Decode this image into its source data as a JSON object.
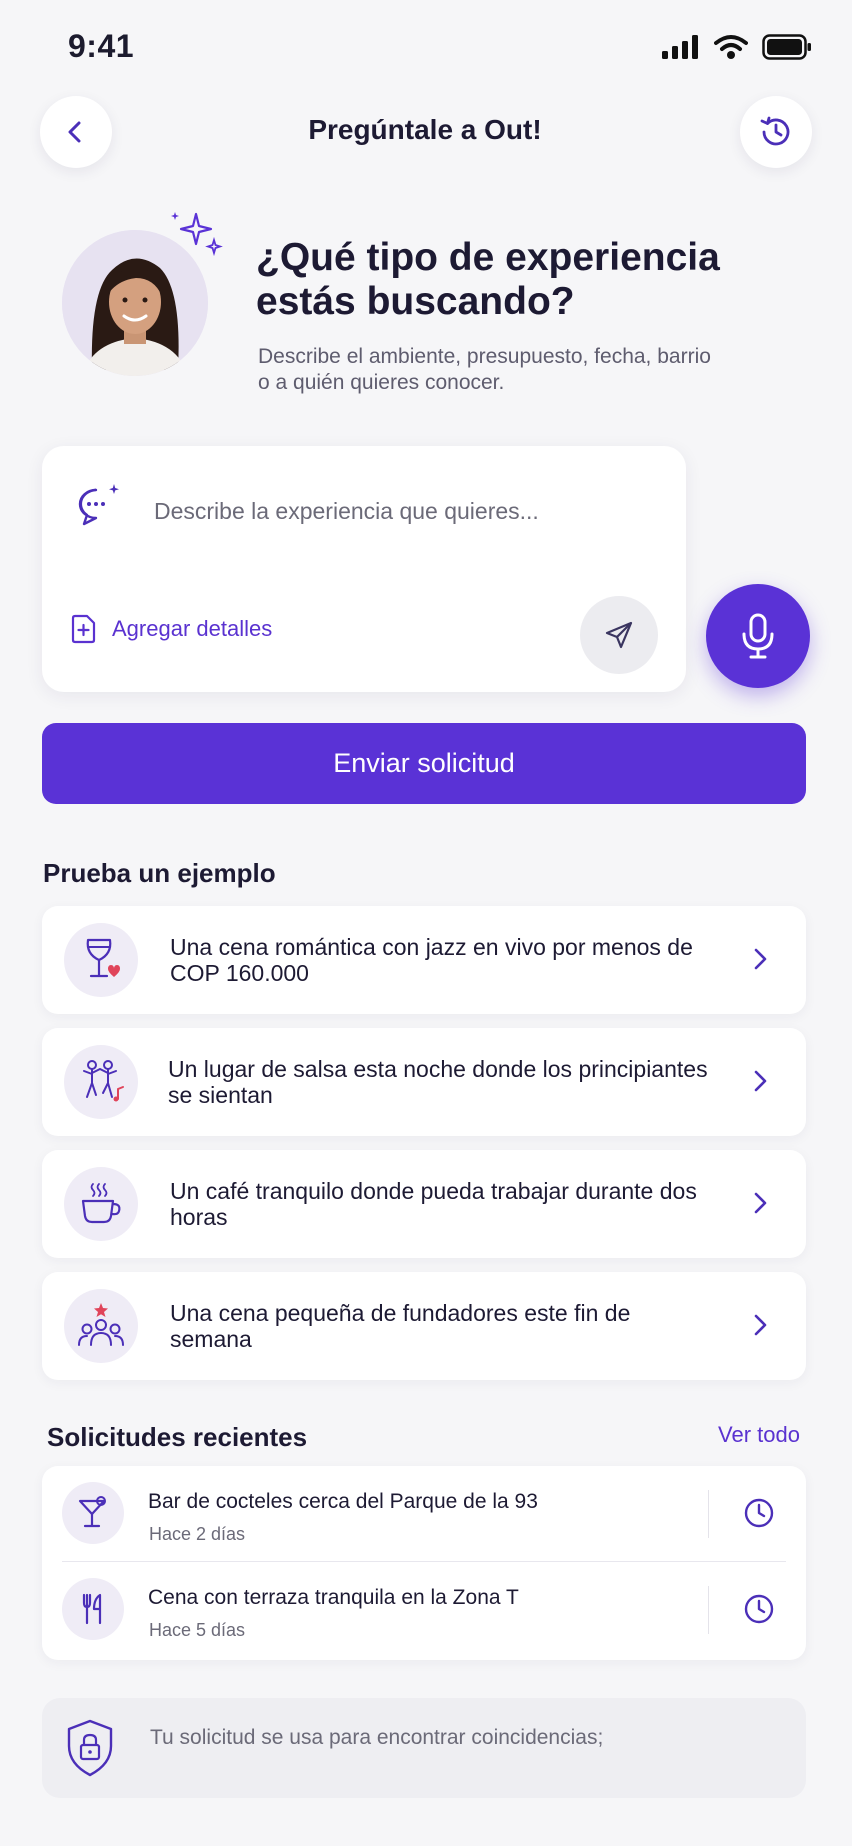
{
  "status": {
    "time": "9:41"
  },
  "header": {
    "title": "Pregúntale a Out!"
  },
  "hero": {
    "title": "¿Qué tipo de experiencia estás buscando?",
    "subtitle": "Describe el ambiente, presupuesto, fecha, barrio o a quién quieres conocer."
  },
  "input": {
    "placeholder": "Describe la experiencia que quieres...",
    "add_details": "Agregar detalles"
  },
  "submit_label": "Enviar solicitud",
  "examples": {
    "title": "Prueba un ejemplo",
    "items": [
      {
        "text": "Una cena romántica con jazz en vivo por menos de COP 160.000",
        "icon": "wine-heart-icon"
      },
      {
        "text": "Un lugar de salsa esta noche donde los principiantes se sientan",
        "icon": "dancers-icon"
      },
      {
        "text": "Un café tranquilo donde pueda trabajar durante dos horas",
        "icon": "coffee-icon"
      },
      {
        "text": "Una cena pequeña de fundadores este fin de semana",
        "icon": "group-star-icon"
      }
    ]
  },
  "recents": {
    "title": "Solicitudes recientes",
    "see_all": "Ver todo",
    "items": [
      {
        "title": "Bar de cocteles cerca del Parque de la 93",
        "time": "Hace 2 días",
        "icon": "cocktail-icon"
      },
      {
        "title": "Cena con terraza tranquila en la Zona T",
        "time": "Hace 5 días",
        "icon": "fork-knife-icon"
      }
    ]
  },
  "privacy": {
    "text": "Tu solicitud se usa para encontrar coincidencias;"
  },
  "colors": {
    "accent": "#5a32d6",
    "background": "#f6f6f8",
    "card": "#ffffff",
    "icon_bg": "#efecf6",
    "heart": "#e0445a"
  }
}
